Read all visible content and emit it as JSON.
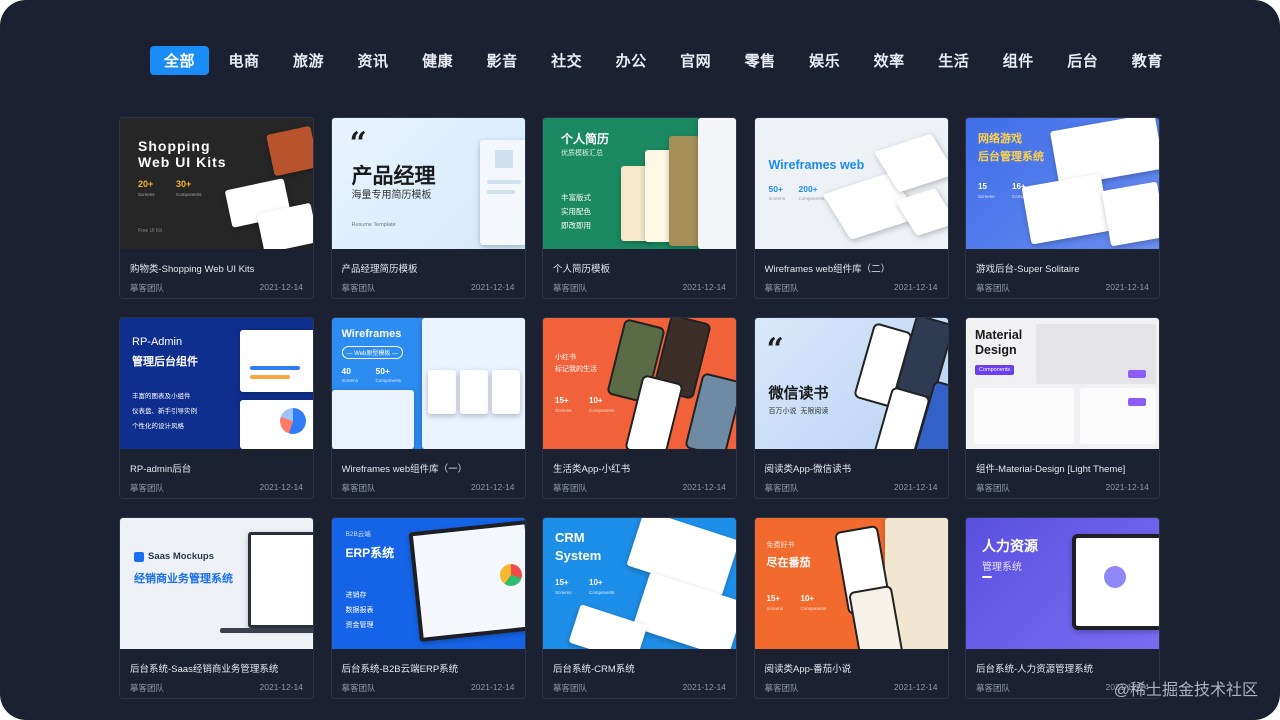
{
  "tabs": [
    {
      "label": "全部",
      "active": true
    },
    {
      "label": "电商"
    },
    {
      "label": "旅游"
    },
    {
      "label": "资讯"
    },
    {
      "label": "健康"
    },
    {
      "label": "影音"
    },
    {
      "label": "社交"
    },
    {
      "label": "办公"
    },
    {
      "label": "官网"
    },
    {
      "label": "零售"
    },
    {
      "label": "娱乐"
    },
    {
      "label": "效率"
    },
    {
      "label": "生活"
    },
    {
      "label": "组件"
    },
    {
      "label": "后台"
    },
    {
      "label": "教育"
    }
  ],
  "cards": [
    {
      "title": "购物类-Shopping Web UI Kits",
      "author": "摹客团队",
      "date": "2021-12-14",
      "thumb": {
        "line1": "Shopping",
        "line2": "Web UI Kits",
        "stat1": "20+",
        "stat1_label": "Screens",
        "stat2": "30+",
        "stat2_label": "Components",
        "foot": "Free UI Kit"
      }
    },
    {
      "title": "产品经理简历模板",
      "author": "摹客团队",
      "date": "2021-12-14",
      "thumb": {
        "quote": "“",
        "line1": "产品经理",
        "line2": "海量专用简历模板",
        "foot": "Resume Template"
      }
    },
    {
      "title": "个人简历模板",
      "author": "摹客团队",
      "date": "2021-12-14",
      "thumb": {
        "line1": "个人简历",
        "line2": "优质模板汇总",
        "items": [
          "丰富版式",
          "实用配色",
          "即改即用"
        ]
      }
    },
    {
      "title": "Wireframes web组件库（二）",
      "author": "摹客团队",
      "date": "2021-12-14",
      "thumb": {
        "line1": "Wireframes web",
        "stat1": "50+",
        "stat1_label": "Screens",
        "stat2": "200+",
        "stat2_label": "Components"
      }
    },
    {
      "title": "游戏后台-Super Solitaire",
      "author": "摹客团队",
      "date": "2021-12-14",
      "thumb": {
        "line1": "网络游戏",
        "line2": "后台管理系统",
        "stat1": "15",
        "stat1_label": "Screens",
        "stat2": "16+",
        "stat2_label": "Components"
      }
    },
    {
      "title": "RP-admin后台",
      "author": "摹客团队",
      "date": "2021-12-14",
      "thumb": {
        "line1": "RP-Admin",
        "line2": "管理后台组件",
        "items": [
          "丰富的图表及小组件",
          "仪表盘、新手引导实例",
          "个性化的设计风格"
        ]
      }
    },
    {
      "title": "Wireframes web组件库（一）",
      "author": "摹客团队",
      "date": "2021-12-14",
      "thumb": {
        "line1": "Wireframes",
        "badge": "— Web原型模板 —",
        "stat1": "40",
        "stat1_label": "Screens",
        "stat2": "50+",
        "stat2_label": "Components"
      }
    },
    {
      "title": "生活类App-小红书",
      "author": "摹客团队",
      "date": "2021-12-14",
      "thumb": {
        "line1": "小红书",
        "line2": "标记我的生活",
        "stat1": "15+",
        "stat1_label": "Screens",
        "stat2": "10+",
        "stat2_label": "Components"
      }
    },
    {
      "title": "阅读类App-微信读书",
      "author": "摹客团队",
      "date": "2021-12-14",
      "thumb": {
        "quote": "“",
        "line1": "微信读书",
        "line2": "百万小说  无限阅读"
      }
    },
    {
      "title": "组件-Material-Design [Light Theme]",
      "author": "摹客团队",
      "date": "2021-12-14",
      "thumb": {
        "line1": "Material",
        "line2": "Design",
        "badge": "Components"
      }
    },
    {
      "title": "后台系统-Saas经销商业务管理系统",
      "author": "摹客团队",
      "date": "2021-12-14",
      "thumb": {
        "line1": "Saas Mockups",
        "line2": "经销商业务管理系统"
      }
    },
    {
      "title": "后台系统-B2B云端ERP系统",
      "author": "摹客团队",
      "date": "2021-12-14",
      "thumb": {
        "line0": "B2B云端",
        "line1": "ERP系统",
        "items": [
          "进销存",
          "数据报表",
          "资金管理"
        ]
      }
    },
    {
      "title": "后台系统-CRM系统",
      "author": "摹客团队",
      "date": "2021-12-14",
      "thumb": {
        "line1": "CRM",
        "line2": "System",
        "stat1": "15+",
        "stat1_label": "Screens",
        "stat2": "10+",
        "stat2_label": "Components"
      }
    },
    {
      "title": "阅读类App-番茄小说",
      "author": "摹客团队",
      "date": "2021-12-14",
      "thumb": {
        "line0": "免费好书",
        "line1": "尽在番茄",
        "stat1": "15+",
        "stat1_label": "Screens",
        "stat2": "10+",
        "stat2_label": "Components"
      }
    },
    {
      "title": "后台系统-人力资源管理系统",
      "author": "摹客团队",
      "date": "2021-12-14",
      "thumb": {
        "line1": "人力资源",
        "line2": "管理系统"
      }
    }
  ],
  "watermark": "@稀土掘金技术社区",
  "colors": {
    "background": "#1b2130",
    "accent": "#1a8cf5",
    "card_border": "#2c3446"
  }
}
